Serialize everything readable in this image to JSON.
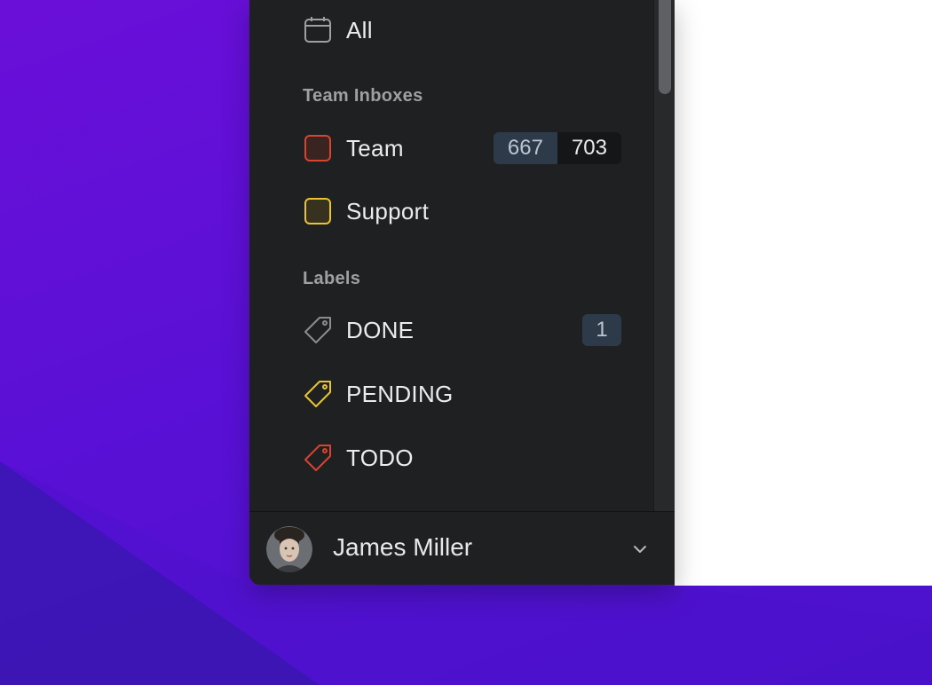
{
  "colors": {
    "sidebar_bg": "#1f2022",
    "team_accent": "#d9432f",
    "support_accent": "#e8c431",
    "done_accent": "#8a8d91",
    "pending_accent": "#e8c431",
    "todo_accent": "#d9432f",
    "badge_bg": "#2c3a4a"
  },
  "sidebar": {
    "all": {
      "label": "All",
      "icon": "calendar-icon"
    },
    "team_inboxes": {
      "title": "Team Inboxes",
      "items": [
        {
          "label": "Team",
          "icon": "square-red-icon",
          "unread": "667",
          "total": "703"
        },
        {
          "label": "Support",
          "icon": "square-yellow-icon"
        }
      ]
    },
    "labels": {
      "title": "Labels",
      "items": [
        {
          "label": "DONE",
          "icon": "tag-gray-icon",
          "count": "1"
        },
        {
          "label": "PENDING",
          "icon": "tag-yellow-icon"
        },
        {
          "label": "TODO",
          "icon": "tag-red-icon"
        }
      ]
    }
  },
  "footer": {
    "user_name": "James Miller",
    "avatar_icon": "user-avatar",
    "menu_icon": "chevron-down-icon"
  }
}
